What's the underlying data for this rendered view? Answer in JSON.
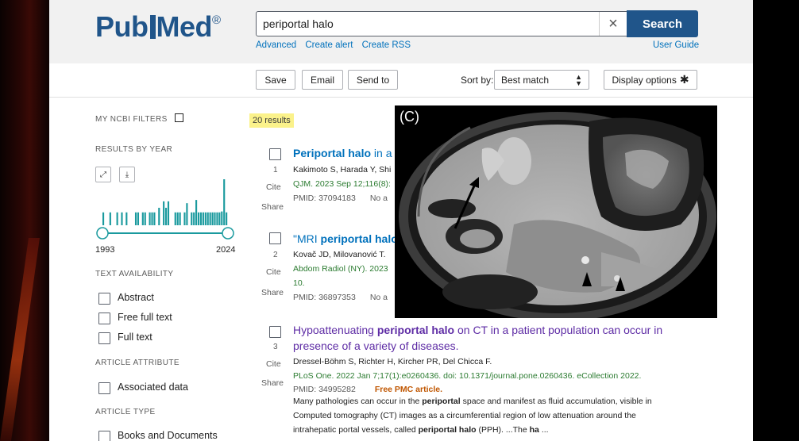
{
  "header": {
    "logo_pub": "Pub",
    "logo_med": "Med",
    "logo_reg": "®",
    "search_value": "periportal halo",
    "clear_glyph": "×",
    "search_button": "Search",
    "links": [
      "Advanced",
      "Create alert",
      "Create RSS"
    ],
    "user_guide": "User Guide"
  },
  "toolbar": {
    "save": "Save",
    "email": "Email",
    "send_to": "Send to",
    "sort_label": "Sort by:",
    "sort_value": "Best match",
    "display_options": "Display options"
  },
  "sidebar": {
    "ncbi_filters": "MY NCBI FILTERS",
    "results_by_year": "RESULTS BY YEAR",
    "year_start": "1993",
    "year_end": "2024",
    "histogram": [
      0.28,
      0,
      0,
      0.28,
      0,
      0,
      0.28,
      0,
      0.28,
      0,
      0.28,
      0,
      0,
      0,
      0.28,
      0.28,
      0,
      0.28,
      0.28,
      0,
      0.28,
      0.28,
      0.28,
      0,
      0.38,
      0,
      0.52,
      0.38,
      0.52,
      0,
      0,
      0.28,
      0.28,
      0.28,
      0,
      0.28,
      0.48,
      0,
      0.28,
      0.28,
      0.55,
      0.28,
      0.28,
      0.28,
      0.28,
      0.28,
      0.28,
      0.28,
      0.28,
      0.28,
      0.28,
      0.3,
      1.0,
      0.28
    ],
    "text_availability": "TEXT AVAILABILITY",
    "text_filters": [
      "Abstract",
      "Free full text",
      "Full text"
    ],
    "article_attribute": "ARTICLE ATTRIBUTE",
    "attribute_filters": [
      "Associated data"
    ],
    "article_type": "ARTICLE TYPE",
    "type_filters": [
      "Books and Documents"
    ]
  },
  "results": {
    "count": "20 results",
    "cite": "Cite",
    "share": "Share",
    "items": [
      {
        "num": "1",
        "title_pre": "",
        "title_bold": "Periportal halo",
        "title_post": " in a p",
        "authors": "Kakimoto S, Harada Y, Shi",
        "citation": "QJM. 2023 Sep 12;116(8):",
        "pmid": "PMID: 37094183",
        "extra": "No a"
      },
      {
        "num": "2",
        "title_pre": "\"MRI ",
        "title_bold": "periportal halo",
        "title_post": "",
        "authors": "Kovač JD, Milovanović T.",
        "citation": "Abdom Radiol (NY). 2023",
        "citation2": "10.",
        "pmid": "PMID: 36897353",
        "extra": "No a"
      },
      {
        "num": "3",
        "title_line1_pre": "Hypoattenuating ",
        "title_line1_bold": "periportal halo",
        "title_line1_post": " on CT in a patient population can occur in",
        "title_line2": "presence of a variety of diseases.",
        "authors": "Dressel-Böhm S, Richter H, Kircher PR, Del Chicca F.",
        "citation": "PLoS One. 2022 Jan 7;17(1):e0260436. doi: 10.1371/journal.pone.0260436. eCollection 2022.",
        "pmid": "PMID: 34995282",
        "free": "Free PMC article.",
        "snippet_a": "Many pathologies can occur in the ",
        "snippet_b": "periportal",
        "snippet_c": " space and manifest as fluid accumulation, visible in",
        "snippet_d": "Computed tomography (CT) images as a circumferential region of low attenuation around the",
        "snippet_e": "intrahepatic portal vessels, called ",
        "snippet_f": "periportal halo",
        "snippet_g": " (PPH). ...The ",
        "snippet_h": "ha",
        "snippet_i": " ..."
      }
    ]
  },
  "overlay": {
    "label": "(C)"
  },
  "colors": {
    "brand": "#20558a",
    "link": "#0071bc",
    "visited": "#5e2ca5",
    "histogram": "#1a9a9e",
    "highlight": "#fbf28b",
    "free_pmc": "#c05600",
    "citation": "#2b7b30"
  }
}
